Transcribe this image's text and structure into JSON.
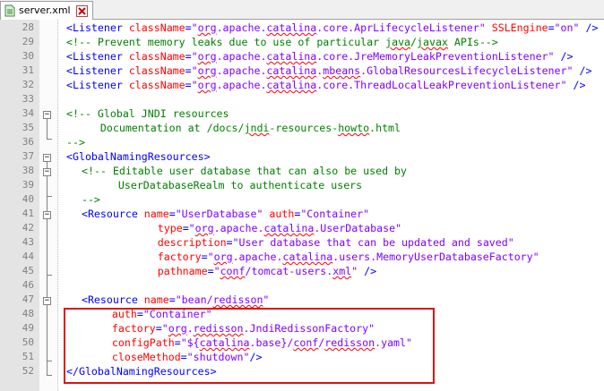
{
  "tab": {
    "label": "server.xml"
  },
  "lines": [
    {
      "n": "28",
      "segs": [
        [
          "tg",
          "<Listener "
        ],
        [
          "at",
          "className"
        ],
        [
          "tg",
          "="
        ],
        [
          "va",
          "\"org.apache.catalina.core.AprLifecycleListener\""
        ],
        [
          "tg",
          " "
        ],
        [
          "at",
          "SSLEngine"
        ],
        [
          "tg",
          "="
        ],
        [
          "va",
          "\"on\""
        ],
        [
          "tg",
          " />"
        ]
      ]
    },
    {
      "n": "29",
      "segs": [
        [
          "cm",
          "<!-- Prevent memory leaks due to use of particular java/javax APIs-->"
        ]
      ]
    },
    {
      "n": "30",
      "segs": [
        [
          "tg",
          "<Listener "
        ],
        [
          "at",
          "className"
        ],
        [
          "tg",
          "="
        ],
        [
          "va",
          "\"org.apache.catalina.core.JreMemoryLeakPreventionListener\""
        ],
        [
          "tg",
          " />"
        ]
      ]
    },
    {
      "n": "31",
      "segs": [
        [
          "tg",
          "<Listener "
        ],
        [
          "at",
          "className"
        ],
        [
          "tg",
          "="
        ],
        [
          "va",
          "\"org.apache.catalina.mbeans.GlobalResourcesLifecycleListener\""
        ],
        [
          "tg",
          " />"
        ]
      ]
    },
    {
      "n": "32",
      "segs": [
        [
          "tg",
          "<Listener "
        ],
        [
          "at",
          "className"
        ],
        [
          "tg",
          "="
        ],
        [
          "va",
          "\"org.apache.catalina.core.ThreadLocalLeakPreventionListener\""
        ],
        [
          "tg",
          " />"
        ]
      ]
    },
    {
      "n": "33",
      "segs": []
    },
    {
      "n": "34",
      "segs": [
        [
          "cm",
          "<!-- Global JNDI resources"
        ]
      ]
    },
    {
      "n": "35",
      "segs": [
        [
          "cm",
          "     Documentation at /docs/jndi-resources-howto.html"
        ]
      ]
    },
    {
      "n": "36",
      "segs": [
        [
          "cm",
          "-->"
        ]
      ]
    },
    {
      "n": "37",
      "segs": [
        [
          "tg",
          "<GlobalNamingResources>"
        ]
      ]
    },
    {
      "n": "38",
      "segs": [
        [
          "cm",
          "  <!-- Editable user database that can also be used by"
        ]
      ]
    },
    {
      "n": "39",
      "segs": [
        [
          "cm",
          "       UserDatabaseRealm to authenticate users"
        ]
      ]
    },
    {
      "n": "40",
      "segs": [
        [
          "cm",
          "  -->"
        ]
      ]
    },
    {
      "n": "41",
      "segs": [
        [
          "tg",
          "  <Resource "
        ],
        [
          "at",
          "name"
        ],
        [
          "tg",
          "="
        ],
        [
          "va",
          "\"UserDatabase\""
        ],
        [
          "tg",
          " "
        ],
        [
          "at",
          "auth"
        ],
        [
          "tg",
          "="
        ],
        [
          "va",
          "\"Container\""
        ]
      ]
    },
    {
      "n": "42",
      "segs": [
        [
          "tg",
          "            "
        ],
        [
          "at",
          "type"
        ],
        [
          "tg",
          "="
        ],
        [
          "va",
          "\"org.apache.catalina.UserDatabase\""
        ]
      ]
    },
    {
      "n": "43",
      "segs": [
        [
          "tg",
          "            "
        ],
        [
          "at",
          "description"
        ],
        [
          "tg",
          "="
        ],
        [
          "va",
          "\"User database that can be updated and saved\""
        ]
      ]
    },
    {
      "n": "44",
      "segs": [
        [
          "tg",
          "            "
        ],
        [
          "at",
          "factory"
        ],
        [
          "tg",
          "="
        ],
        [
          "va",
          "\"org.apache.catalina.users.MemoryUserDatabaseFactory\""
        ]
      ]
    },
    {
      "n": "45",
      "segs": [
        [
          "tg",
          "            "
        ],
        [
          "at",
          "pathname"
        ],
        [
          "tg",
          "="
        ],
        [
          "va",
          "\"conf/tomcat-users.xml\""
        ],
        [
          "tg",
          " />"
        ]
      ]
    },
    {
      "n": "46",
      "segs": []
    },
    {
      "n": "47",
      "segs": [
        [
          "tg",
          "  <Resource "
        ],
        [
          "at",
          "name"
        ],
        [
          "tg",
          "="
        ],
        [
          "va",
          "\"bean/redisson\""
        ]
      ]
    },
    {
      "n": "48",
      "segs": [
        [
          "tg",
          "      "
        ],
        [
          "at",
          "auth"
        ],
        [
          "tg",
          "="
        ],
        [
          "va",
          "\"Container\""
        ]
      ]
    },
    {
      "n": "49",
      "segs": [
        [
          "tg",
          "      "
        ],
        [
          "at",
          "factory"
        ],
        [
          "tg",
          "="
        ],
        [
          "va",
          "\"org.redisson.JndiRedissonFactory\""
        ]
      ]
    },
    {
      "n": "50",
      "segs": [
        [
          "tg",
          "      "
        ],
        [
          "at",
          "configPath"
        ],
        [
          "tg",
          "="
        ],
        [
          "va",
          "\"${catalina.base}/conf/redisson.yaml\""
        ]
      ]
    },
    {
      "n": "51",
      "segs": [
        [
          "tg",
          "      "
        ],
        [
          "at",
          "closeMethod"
        ],
        [
          "tg",
          "="
        ],
        [
          "va",
          "\"shutdown\""
        ],
        [
          "tg",
          "/>"
        ]
      ]
    },
    {
      "n": "52",
      "segs": [
        [
          "tg",
          "</GlobalNamingResources>"
        ]
      ]
    }
  ],
  "squiggle_words": [
    "java",
    "javax",
    "org",
    "catalina",
    "mbeans",
    "jndi",
    "howto",
    "conf",
    "xml",
    "redisson",
    "Jndi"
  ],
  "colors": {
    "tag": "#0000ff",
    "attr": "#ff0000",
    "value": "#8000ff",
    "comment": "#008000",
    "highlight": "#e01010"
  }
}
